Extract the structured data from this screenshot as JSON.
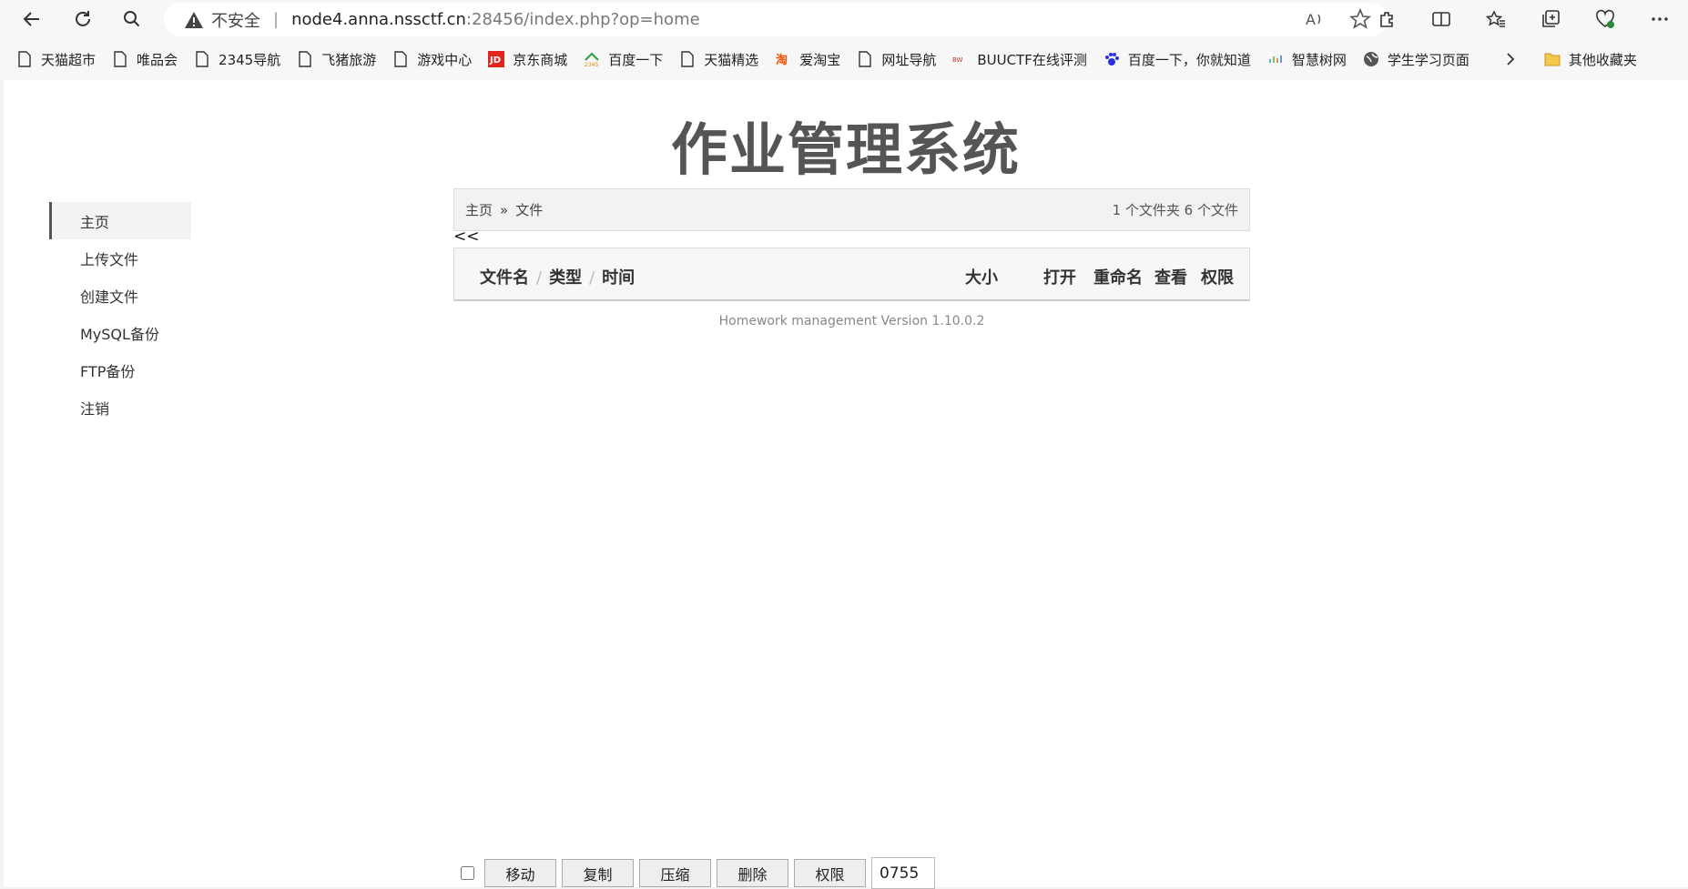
{
  "browser": {
    "address": {
      "insecure_label": "不安全",
      "host": "node4.anna.nssctf.cn",
      "path": ":28456/index.php?op=home"
    },
    "bookmarks": [
      {
        "label": "天猫超市",
        "icon": "page-icon"
      },
      {
        "label": "唯品会",
        "icon": "page-icon"
      },
      {
        "label": "2345导航",
        "icon": "page-icon"
      },
      {
        "label": "飞猪旅游",
        "icon": "page-icon"
      },
      {
        "label": "游戏中心",
        "icon": "page-icon"
      },
      {
        "label": "京东商城",
        "icon": "jd-icon"
      },
      {
        "label": "百度一下",
        "icon": "2345-icon"
      },
      {
        "label": "天猫精选",
        "icon": "page-icon"
      },
      {
        "label": "爱淘宝",
        "icon": "taobao-icon"
      },
      {
        "label": "网址导航",
        "icon": "page-icon"
      },
      {
        "label": "BUUCTF在线评测",
        "icon": "buu-icon"
      },
      {
        "label": "百度一下，你就知道",
        "icon": "baidu-icon"
      },
      {
        "label": "智慧树网",
        "icon": "zhihuishu-icon"
      },
      {
        "label": "学生学习页面",
        "icon": "globe-icon"
      }
    ],
    "other_bookmarks": "其他收藏夹"
  },
  "app": {
    "title": "作业管理系统",
    "sidebar": [
      {
        "label": "主页",
        "active": true
      },
      {
        "label": "上传文件"
      },
      {
        "label": "创建文件"
      },
      {
        "label": "MySQL备份"
      },
      {
        "label": "FTP备份"
      },
      {
        "label": "注销"
      }
    ],
    "breadcrumb": {
      "home": "主页",
      "sep": "»",
      "current": "文件"
    },
    "counts": "1 个文件夹 6 个文件",
    "back": "<<",
    "table_headers": {
      "name": "文件名",
      "type": "类型",
      "time": "时间",
      "size": "大小",
      "open": "打开",
      "rename": "重命名",
      "view": "查看",
      "perm": "权限",
      "sep": "/"
    },
    "footer": "Homework management Version 1.10.0.2",
    "actions": {
      "move": "移动",
      "copy": "复制",
      "compress": "压缩",
      "delete": "删除",
      "perm": "权限",
      "perm_value": "0755"
    }
  }
}
